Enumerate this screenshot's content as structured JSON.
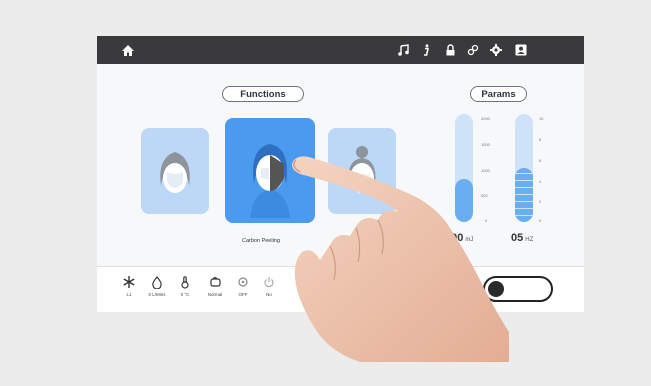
{
  "header": {
    "icons": [
      "home-icon",
      "music-icon",
      "info-icon",
      "lock-icon",
      "link-icon",
      "gear-icon",
      "user-icon"
    ]
  },
  "functions": {
    "title": "Functions",
    "selected_caption": "Carbon Peeling"
  },
  "params": {
    "title": "Params",
    "energy": {
      "value": "800",
      "unit": "mJ",
      "ticks": [
        "2000",
        "1500",
        "1000",
        "500",
        "0"
      ],
      "level_fraction": 0.4
    },
    "frequency": {
      "value": "05",
      "unit": "HZ",
      "ticks": [
        "10",
        "8",
        "6",
        "4",
        "2",
        "0"
      ],
      "level_fraction": 0.5
    }
  },
  "bottom": {
    "items": [
      {
        "icon": "snowflake-icon",
        "label": "L1"
      },
      {
        "icon": "water-drop-icon",
        "label": "0 L/Mins"
      },
      {
        "icon": "temperature-icon",
        "label": "0 °C"
      },
      {
        "icon": "mode-icon",
        "label": "Normal"
      },
      {
        "icon": "aim-icon",
        "label": "OFF"
      },
      {
        "icon": "power-icon",
        "label": "No"
      }
    ],
    "toggle_on": false
  },
  "colors": {
    "topbar": "#3a3a3c",
    "accent": "#4a9af0",
    "card_light": "#bcd8f6",
    "bar_track": "#cfe3f8",
    "bar_fill": "#68aef0"
  }
}
